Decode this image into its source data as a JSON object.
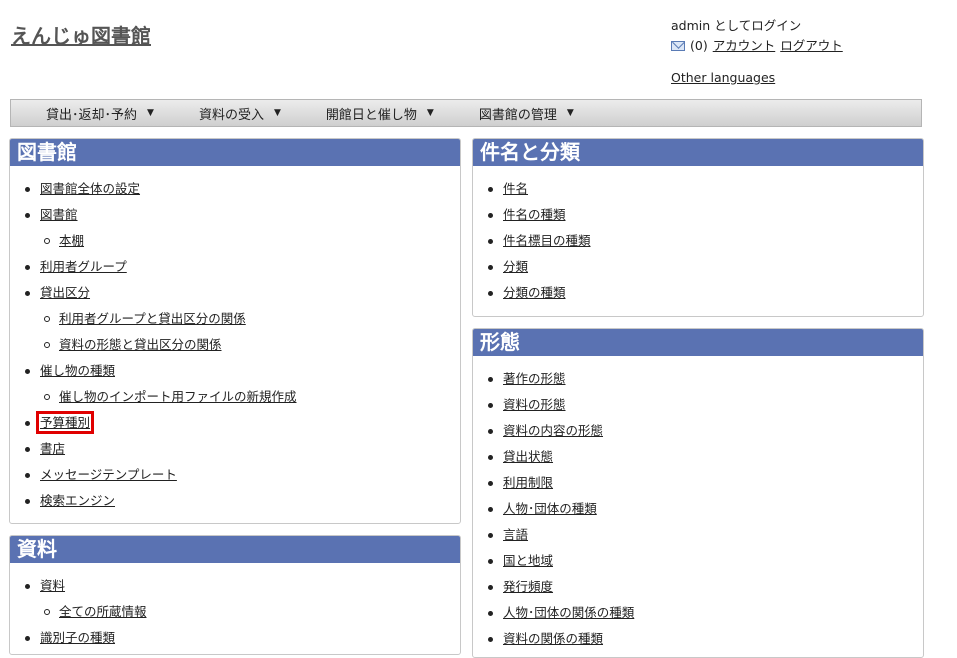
{
  "site": {
    "title": "えんじゅ図書館"
  },
  "user": {
    "login_text": "admin としてログイン",
    "message_count": "(0)",
    "account_link": "アカウント",
    "logout_link": "ログアウト",
    "other_languages": "Other languages"
  },
  "menu": [
    {
      "label": "貸出･返却･予約"
    },
    {
      "label": "資料の受入"
    },
    {
      "label": "開館日と催し物"
    },
    {
      "label": "図書館の管理"
    }
  ],
  "panels": {
    "library": {
      "title": "図書館",
      "items": [
        {
          "label": "図書館全体の設定",
          "level": 1
        },
        {
          "label": "図書館",
          "level": 1
        },
        {
          "label": "本棚",
          "level": 2
        },
        {
          "label": "利用者グループ",
          "level": 1
        },
        {
          "label": "貸出区分",
          "level": 1
        },
        {
          "label": "利用者グループと貸出区分の関係",
          "level": 2
        },
        {
          "label": "資料の形態と貸出区分の関係",
          "level": 2
        },
        {
          "label": "催し物の種類",
          "level": 1
        },
        {
          "label": "催し物のインポート用ファイルの新規作成",
          "level": 2
        },
        {
          "label": "予算種別",
          "level": 1,
          "highlighted": true
        },
        {
          "label": "書店",
          "level": 1
        },
        {
          "label": "メッセージテンプレート",
          "level": 1
        },
        {
          "label": "検索エンジン",
          "level": 1
        }
      ]
    },
    "subject": {
      "title": "件名と分類",
      "items": [
        {
          "label": "件名",
          "level": 1
        },
        {
          "label": "件名の種類",
          "level": 1
        },
        {
          "label": "件名標目の種類",
          "level": 1
        },
        {
          "label": "分類",
          "level": 1
        },
        {
          "label": "分類の種類",
          "level": 1
        }
      ]
    },
    "form": {
      "title": "形態",
      "items": [
        {
          "label": "著作の形態",
          "level": 1
        },
        {
          "label": "資料の形態",
          "level": 1
        },
        {
          "label": "資料の内容の形態",
          "level": 1
        },
        {
          "label": "貸出状態",
          "level": 1
        },
        {
          "label": "利用制限",
          "level": 1
        },
        {
          "label": "人物･団体の種類",
          "level": 1
        },
        {
          "label": "言語",
          "level": 1
        },
        {
          "label": "国と地域",
          "level": 1
        },
        {
          "label": "発行頻度",
          "level": 1
        },
        {
          "label": "人物･団体の関係の種類",
          "level": 1
        },
        {
          "label": "資料の関係の種類",
          "level": 1
        }
      ]
    },
    "resource": {
      "title": "資料",
      "items": [
        {
          "label": "資料",
          "level": 1
        },
        {
          "label": "全ての所蔵情報",
          "level": 2
        },
        {
          "label": "識別子の種類",
          "level": 1
        }
      ]
    }
  },
  "colors": {
    "header_bg": "#5a72b2",
    "highlight": "#e00000"
  }
}
